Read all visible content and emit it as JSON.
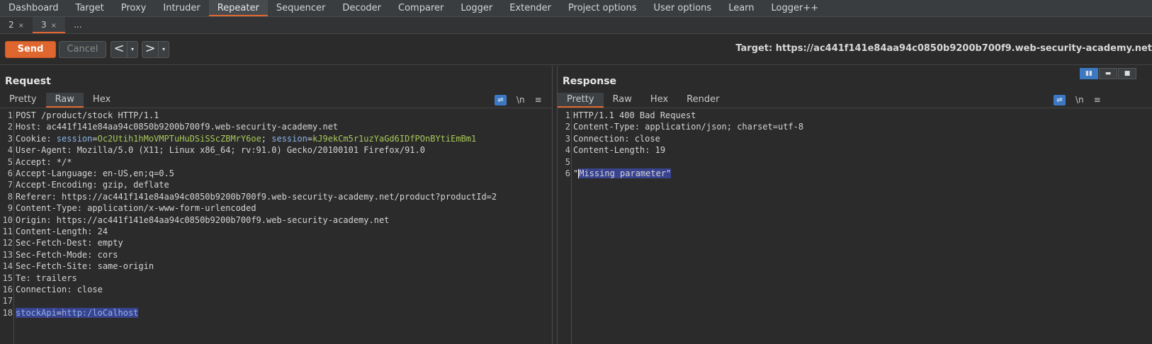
{
  "top_tabs": [
    "Dashboard",
    "Target",
    "Proxy",
    "Intruder",
    "Repeater",
    "Sequencer",
    "Decoder",
    "Comparer",
    "Logger",
    "Extender",
    "Project options",
    "User options",
    "Learn",
    "Logger++"
  ],
  "active_top_tab": "Repeater",
  "sub_tabs": [
    {
      "label": "2",
      "close": "×"
    },
    {
      "label": "3",
      "close": "×"
    },
    {
      "label": "...",
      "close": ""
    }
  ],
  "toolbar": {
    "send_label": "Send",
    "cancel_label": "Cancel",
    "back_icon": "<",
    "forward_icon": ">",
    "dropdown_icon": "▾",
    "target_text": "Target: https://ac441f141e84aa94c0850b9200b700f9.web-security-academy.net"
  },
  "request": {
    "title": "Request",
    "tabs": [
      "Pretty",
      "Raw",
      "Hex"
    ],
    "active_tab": "Raw",
    "icons": [
      "wrap-icon",
      "newline-icon",
      "menu-icon"
    ],
    "newline_label": "\\n",
    "menu_label": "≡",
    "lines": [
      {
        "n": "1",
        "text": "POST /product/stock HTTP/1.1"
      },
      {
        "n": "2",
        "text": "Host: ac441f141e84aa94c0850b9200b700f9.web-security-academy.net"
      },
      {
        "n": "3",
        "text": "Cookie: session=Oc2Utih1hMoVMPTuHuDSiSScZBMrY6oe; session=kJ9ekCm5r1uzYaGd6IDfPOnBYtiEmBm1"
      },
      {
        "n": "4",
        "text": "User-Agent: Mozilla/5.0 (X11; Linux x86_64; rv:91.0) Gecko/20100101 Firefox/91.0"
      },
      {
        "n": "5",
        "text": "Accept: */*"
      },
      {
        "n": "6",
        "text": "Accept-Language: en-US,en;q=0.5"
      },
      {
        "n": "7",
        "text": "Accept-Encoding: gzip, deflate"
      },
      {
        "n": "8",
        "text": "Referer: https://ac441f141e84aa94c0850b9200b700f9.web-security-academy.net/product?productId=2"
      },
      {
        "n": "9",
        "text": "Content-Type: application/x-www-form-urlencoded"
      },
      {
        "n": "10",
        "text": "Origin: https://ac441f141e84aa94c0850b9200b700f9.web-security-academy.net"
      },
      {
        "n": "11",
        "text": "Content-Length: 24"
      },
      {
        "n": "12",
        "text": "Sec-Fetch-Dest: empty"
      },
      {
        "n": "13",
        "text": "Sec-Fetch-Mode: cors"
      },
      {
        "n": "14",
        "text": "Sec-Fetch-Site: same-origin"
      },
      {
        "n": "15",
        "text": "Te: trailers"
      },
      {
        "n": "16",
        "text": "Connection: close"
      },
      {
        "n": "17",
        "text": ""
      },
      {
        "n": "18",
        "text": "stockApi=http:/loCalhost"
      }
    ],
    "cookie": {
      "prefix": "Cookie: ",
      "k1": "session",
      "v1": "Oc2Utih1hMoVMPTuHuDSiSScZBMrY6oe",
      "sep": "; ",
      "k2": "session",
      "v2": "kJ9ekCm5r1uzYaGd6IDfPOnBYtiEmBm1"
    },
    "body_param": {
      "key": "stockApi",
      "eq": "=",
      "value": "http:/loCalhost"
    }
  },
  "response": {
    "title": "Response",
    "tabs": [
      "Pretty",
      "Raw",
      "Hex",
      "Render"
    ],
    "active_tab": "Pretty",
    "newline_label": "\\n",
    "menu_label": "≡",
    "lines": [
      {
        "n": "1",
        "text": "HTTP/1.1 400 Bad Request"
      },
      {
        "n": "2",
        "text": "Content-Type: application/json; charset=utf-8"
      },
      {
        "n": "3",
        "text": "Connection: close"
      },
      {
        "n": "4",
        "text": "Content-Length: 19"
      },
      {
        "n": "5",
        "text": ""
      },
      {
        "n": "6",
        "text": "\"Missing parameter\""
      }
    ],
    "body_quote_open": "\"",
    "body_text": "Missing parameter\""
  },
  "colors": {
    "accent": "#e0662f",
    "selection": "#3a4390",
    "blue_icon": "#3d79c2"
  }
}
